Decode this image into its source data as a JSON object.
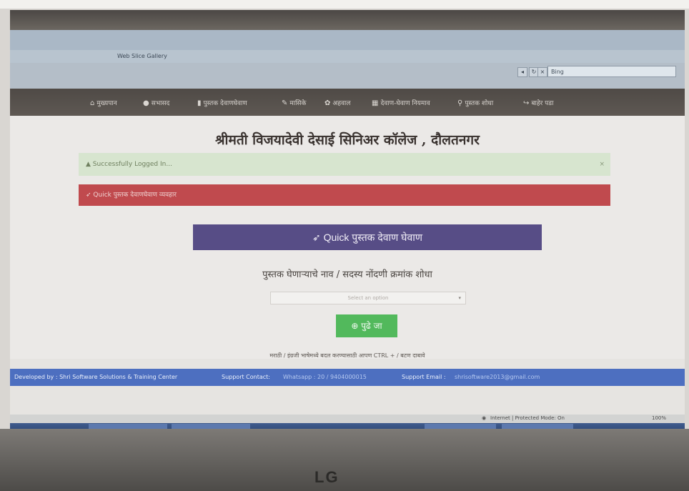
{
  "browser": {
    "search_box": "Bing",
    "tab_label": "Web Slice Gallery"
  },
  "nav": {
    "items": [
      {
        "icon": "home-icon",
        "label": "मुख्यपान"
      },
      {
        "icon": "user-icon",
        "label": "सभासद"
      },
      {
        "icon": "book-icon",
        "label": "पुस्तक देवाणघेवाण"
      },
      {
        "icon": "book-icon",
        "label": "मासिके"
      },
      {
        "icon": "paw-icon",
        "label": "अहवाल"
      },
      {
        "icon": "calendar-icon",
        "label": "देवाण-घेवाण नियमाव"
      },
      {
        "icon": "search-icon",
        "label": "पुस्तक शोधा"
      },
      {
        "icon": "signout-icon",
        "label": "बाहेर पडा"
      }
    ]
  },
  "page": {
    "college_title": "श्रीमती विजयादेवी देसाई सिनिअर कॉलेज , दौलतनगर",
    "success_message": "Successfully Logged In...",
    "danger_message": "Quick पुस्तक देवाणघेवाण व्यवहार",
    "panel_heading": "Quick पुस्तक देवाण घेवाण",
    "search_label": "पुस्तक घेणाऱ्याचे नाव / सदस्य नोंदणी क्रमांक शोधा",
    "select_placeholder": "Select an option",
    "go_button": "पुढे जा",
    "hint": "मराठी / इंग्रजी भाषेमध्ये बदल करण्यासाठी आपण CTRL + / बटण दाबावे"
  },
  "footer": {
    "developed_by": "Developed by : Shri Software Solutions & Training Center",
    "support_contact_label": "Support Contact:",
    "support_contact_value": "Whatsapp : 20 / 9404000015",
    "support_email_label": "Support Email :",
    "support_email_value": "shrisoftware2013@gmail.com"
  },
  "status": {
    "zone": "Internet | Protected Mode: On",
    "zoom": "100%"
  },
  "brand": {
    "monitor_logo": "LG"
  },
  "colors": {
    "navbar": "#534d48",
    "success": "#d7e5cf",
    "danger": "#c04a4e",
    "panel": "#574d86",
    "go_button": "#52b95c",
    "footer": "#4d6fc0"
  }
}
